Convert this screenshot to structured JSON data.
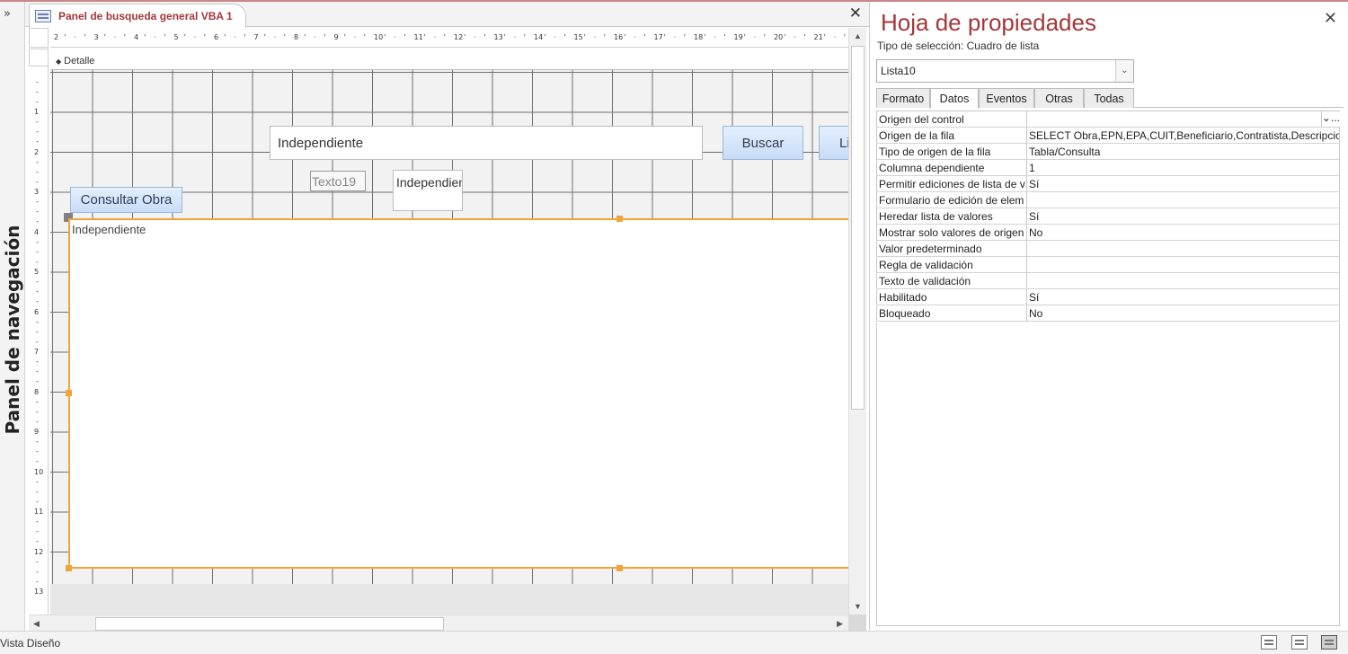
{
  "document": {
    "tab_title": "Panel de busqueda general VBA 1",
    "close_glyph": "✕"
  },
  "nav_pane": {
    "expand_glyph": "»",
    "label": "Panel de navegación"
  },
  "ruler": {
    "horizontal_ticks": [
      "2",
      "3",
      "4",
      "5",
      "6",
      "7",
      "8",
      "9",
      "10",
      "11",
      "12",
      "13",
      "14",
      "15",
      "16",
      "17",
      "18",
      "19",
      "20",
      "21"
    ],
    "vertical_ticks": [
      "1",
      "2",
      "3",
      "4",
      "5",
      "6",
      "7",
      "8",
      "9",
      "10",
      "11",
      "12",
      "13"
    ]
  },
  "section": {
    "label": "Detalle"
  },
  "form_controls": {
    "search_textbox": "Independiente",
    "search_button": "Buscar",
    "clipped_button": "Li",
    "label_texto19": "Texto19",
    "small_textbox": "Independiente",
    "consultar_button": "Consultar Obra",
    "listbox_text": "Independiente"
  },
  "property_sheet": {
    "title": "Hoja de propiedades",
    "close_glyph": "✕",
    "selection_type_label": "Tipo de selección:",
    "selection_type_value": "Cuadro de lista",
    "selected_object": "Lista10",
    "tabs": [
      "Formato",
      "Datos",
      "Eventos",
      "Otras",
      "Todas"
    ],
    "active_tab": "Datos",
    "properties": [
      {
        "name": "Origen del control",
        "value": ""
      },
      {
        "name": "Origen de la fila",
        "value": "SELECT Obra,EPN,EPA,CUIT,Beneficiario,Contratista,Descripcion,"
      },
      {
        "name": "Tipo de origen de la fila",
        "value": "Tabla/Consulta"
      },
      {
        "name": "Columna dependiente",
        "value": "1"
      },
      {
        "name": "Permitir ediciones de lista de v",
        "value": "Sí"
      },
      {
        "name": "Formulario de edición de elem",
        "value": ""
      },
      {
        "name": "Heredar lista de valores",
        "value": "Sí"
      },
      {
        "name": "Mostrar solo valores de origen",
        "value": "No"
      },
      {
        "name": "Valor predeterminado",
        "value": ""
      },
      {
        "name": "Regla de validación",
        "value": ""
      },
      {
        "name": "Texto de validación",
        "value": ""
      },
      {
        "name": "Habilitado",
        "value": "Sí"
      },
      {
        "name": "Bloqueado",
        "value": "No"
      }
    ],
    "builder_glyph": "...",
    "dropdown_glyph": "⌄"
  },
  "status_bar": {
    "view_text": "Vista Diseño"
  },
  "colors": {
    "accent": "#a4373a",
    "selection": "#f1a43a",
    "button_fill": "#c8dcf8"
  }
}
